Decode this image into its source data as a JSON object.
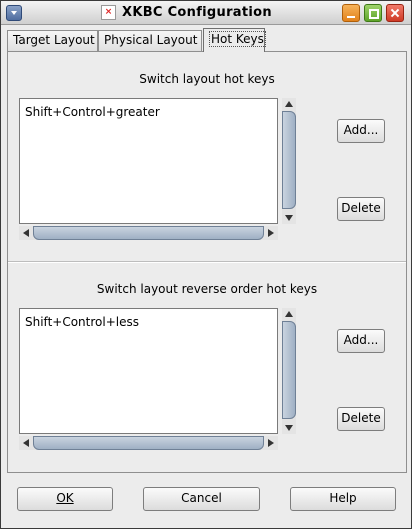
{
  "window": {
    "title": "XKBC Configuration",
    "app_icon_glyph": "×"
  },
  "tabs": [
    {
      "label": "Target Layout",
      "active": false
    },
    {
      "label": "Physical Layout",
      "active": false
    },
    {
      "label": "Hot Keys",
      "active": true
    }
  ],
  "hotkeys": {
    "title": "Switch layout hot keys",
    "items": [
      "Shift+Control+greater"
    ],
    "add_label": "Add...",
    "delete_label": "Delete"
  },
  "reverse_hotkeys": {
    "title": "Switch layout reverse order hot keys",
    "items": [
      "Shift+Control+less"
    ],
    "add_label": "Add...",
    "delete_label": "Delete"
  },
  "footer": {
    "ok_label": "OK",
    "cancel_label": "Cancel",
    "help_label": "Help"
  },
  "icons": [
    "window-menu-icon",
    "app-icon",
    "minimize-icon",
    "maximize-icon",
    "close-icon",
    "scroll-up-icon",
    "scroll-down-icon",
    "scroll-left-icon",
    "scroll-right-icon"
  ],
  "colors": {
    "minimize": "#e2821c",
    "maximize": "#5ea32a",
    "close": "#cf3a26",
    "scroll_thumb": "#9fb0c4"
  }
}
